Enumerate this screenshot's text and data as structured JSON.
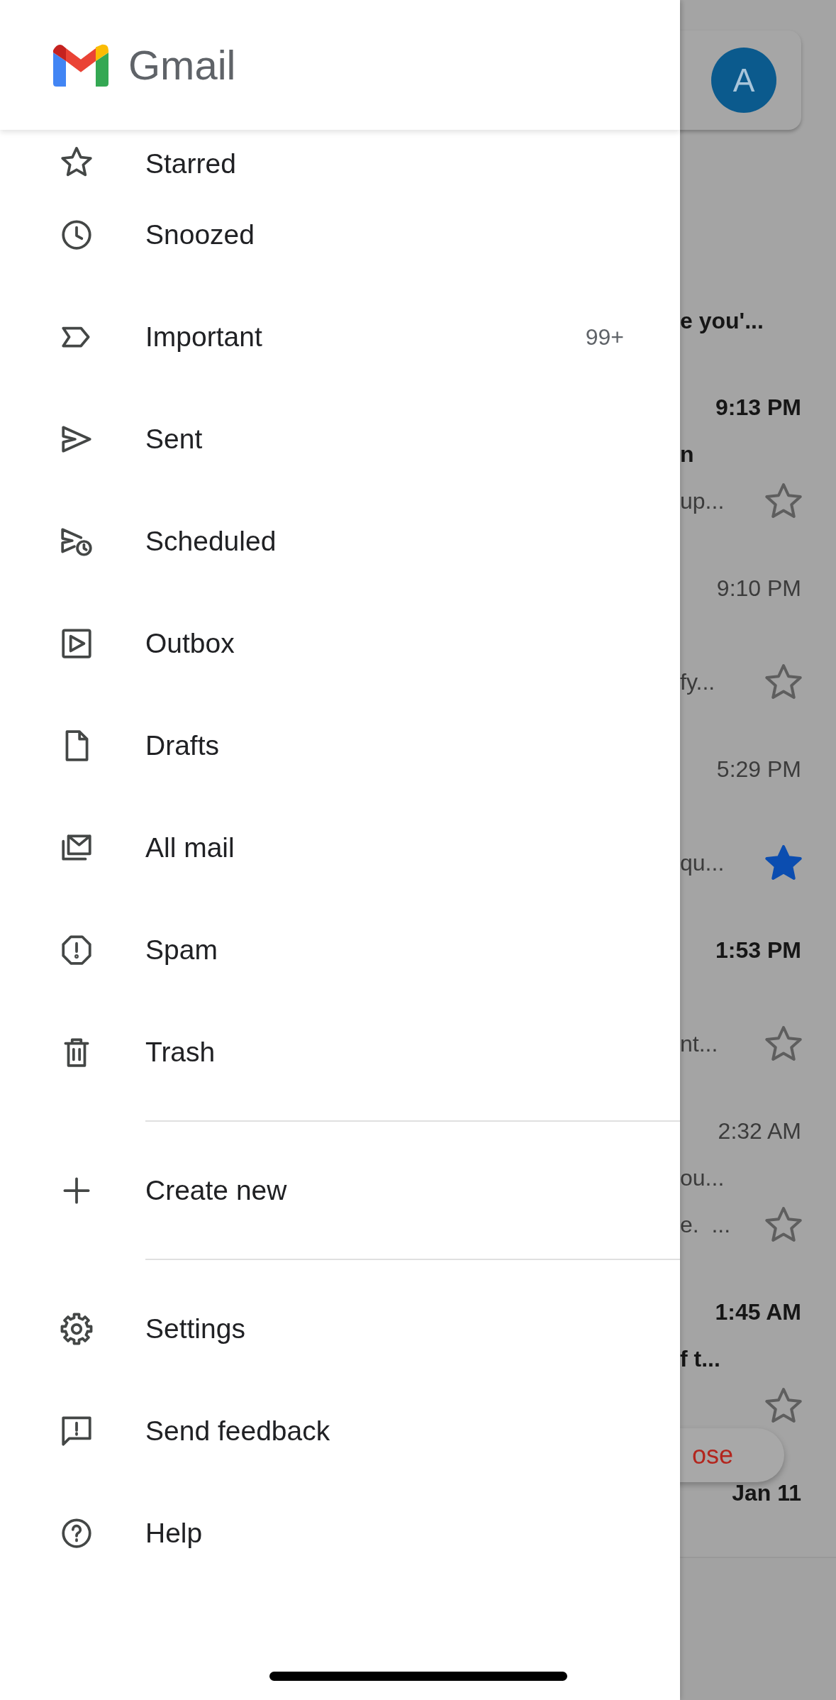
{
  "header": {
    "app_name": "Gmail"
  },
  "folders": [
    {
      "label": "Starred"
    },
    {
      "label": "Snoozed"
    },
    {
      "label": "Important",
      "count": "99+"
    },
    {
      "label": "Sent"
    },
    {
      "label": "Scheduled"
    },
    {
      "label": "Outbox"
    },
    {
      "label": "Drafts"
    },
    {
      "label": "All mail"
    },
    {
      "label": "Spam"
    },
    {
      "label": "Trash"
    }
  ],
  "labels_section": [
    {
      "label": "Create new"
    }
  ],
  "footer_items": [
    {
      "label": "Settings"
    },
    {
      "label": "Send feedback"
    },
    {
      "label": "Help"
    }
  ],
  "background_inbox": {
    "avatar": {
      "initial": "A"
    },
    "banner_text": "e you'...",
    "emails": [
      {
        "time": "9:13 PM",
        "unread": true,
        "subject": "n",
        "snippet": "up...",
        "starred": false
      },
      {
        "time": "9:10 PM",
        "unread": false,
        "snippet": "fy...",
        "starred": false
      },
      {
        "time": "5:29 PM",
        "unread": false,
        "snippet": "qu...",
        "starred": true
      },
      {
        "time": "1:53 PM",
        "unread": true,
        "snippet": "nt...",
        "starred": false
      },
      {
        "time": "2:32 AM",
        "unread": false,
        "subject": "ou...",
        "snippet": "e.  ...",
        "starred": false
      },
      {
        "time": "1:45 AM",
        "unread": true,
        "subject": "f t...",
        "starred": false
      },
      {
        "time": "Jan 11",
        "unread": true
      }
    ],
    "compose_button": {
      "label": "ose"
    }
  }
}
